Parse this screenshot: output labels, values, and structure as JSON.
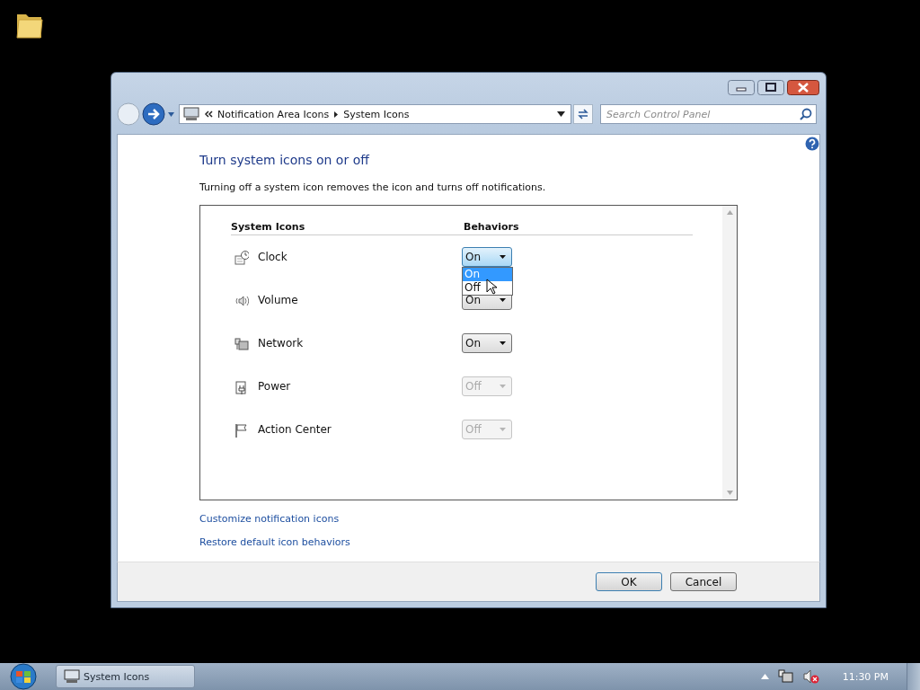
{
  "window": {
    "address_bar": {
      "breadcrumb": [
        "Notification Area Icons",
        "System Icons"
      ]
    },
    "search": {
      "placeholder": "Search Control Panel"
    },
    "heading": "Turn system icons on or off",
    "description": "Turning off a system icon removes the icon and turns off notifications.",
    "table": {
      "columns": [
        "System Icons",
        "Behaviors"
      ],
      "rows": [
        {
          "kind": "clock",
          "name": "Clock",
          "value": "On",
          "disabled": false,
          "expanded": true,
          "options": [
            {
              "label": "On",
              "selected": true
            },
            {
              "label": "Off",
              "selected": false
            }
          ]
        },
        {
          "kind": "volume",
          "name": "Volume",
          "value": "On",
          "disabled": false,
          "expanded": false
        },
        {
          "kind": "network",
          "name": "Network",
          "value": "On",
          "disabled": false,
          "expanded": false
        },
        {
          "kind": "power",
          "name": "Power",
          "value": "Off",
          "disabled": true,
          "expanded": false
        },
        {
          "kind": "flag",
          "name": "Action Center",
          "value": "Off",
          "disabled": true,
          "expanded": false
        }
      ]
    },
    "links": [
      "Customize notification icons",
      "Restore default icon behaviors"
    ],
    "buttons": [
      "OK",
      "Cancel"
    ]
  },
  "taskbar": {
    "tasks": [
      {
        "label": "System Icons",
        "selected": true
      }
    ],
    "clock": "11:30 PM"
  }
}
